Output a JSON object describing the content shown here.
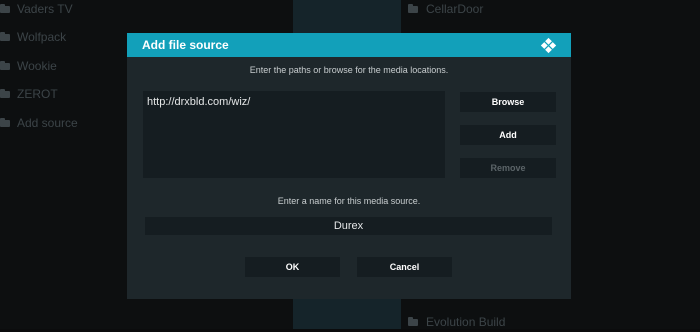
{
  "background": {
    "left_list": [
      "Vaders TV",
      "Wolfpack",
      "Wookie",
      "ZEROT",
      "Add source"
    ],
    "right_list": [
      "CellarDoor",
      "Evolution Build"
    ]
  },
  "dialog": {
    "title": "Add file source",
    "logo_icon": "kodi-logo-icon",
    "paths_instruction": "Enter the paths or browse for the media locations.",
    "paths": [
      "http://drxbld.com/wiz/"
    ],
    "browse_label": "Browse",
    "add_label": "Add",
    "remove_label": "Remove",
    "name_instruction": "Enter a name for this media source.",
    "source_name": "Durex",
    "ok_label": "OK",
    "cancel_label": "Cancel"
  },
  "colors": {
    "header_accent": "#12a0ba",
    "dialog_bg": "#1e272b",
    "field_bg": "#151d21"
  }
}
